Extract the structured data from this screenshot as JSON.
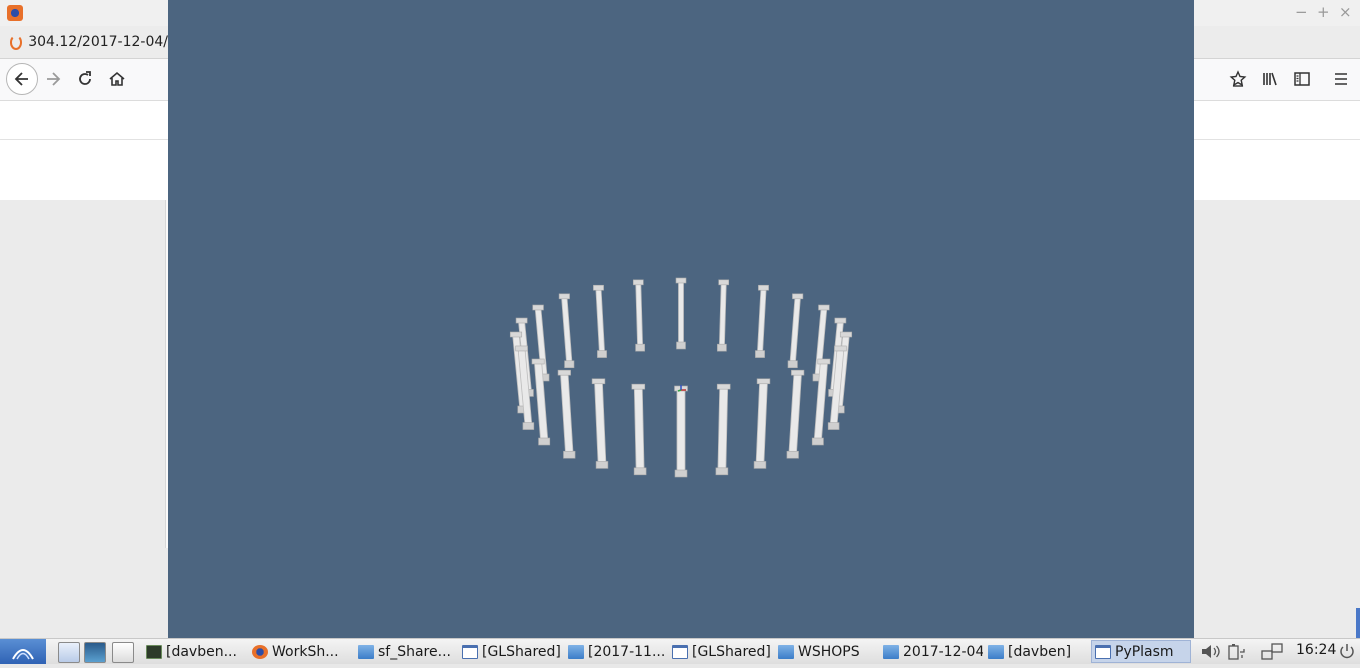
{
  "browser": {
    "tab": {
      "title": "304.12/2017-12-04/"
    },
    "window_controls": {
      "minimize": "−",
      "maximize": "+",
      "close": "×"
    },
    "toolbar_icons": [
      "back-icon",
      "forward-icon",
      "reload-icon",
      "home-icon",
      "bookmark-star-icon",
      "library-icon",
      "sidebar-icon",
      "menu-icon"
    ]
  },
  "viewer": {
    "background": "#4c6580",
    "scene": "ring of white columns"
  },
  "taskbar": {
    "tasks": [
      {
        "label": "[davben...",
        "icon": "terminal-icon"
      },
      {
        "label": "WorkSh...",
        "icon": "firefox-icon"
      },
      {
        "label": "sf_Share...",
        "icon": "folder-icon"
      },
      {
        "label": "[GLShared]",
        "icon": "window-icon"
      },
      {
        "label": "[2017-11...",
        "icon": "folder-icon"
      },
      {
        "label": "[GLShared]",
        "icon": "window-icon"
      },
      {
        "label": "WSHOPS",
        "icon": "folder-icon"
      },
      {
        "label": "2017-12-04",
        "icon": "folder-icon"
      },
      {
        "label": "[davben]",
        "icon": "folder-icon"
      },
      {
        "label": "PyPlasm",
        "icon": "window-icon"
      }
    ],
    "clock": "16:24"
  }
}
